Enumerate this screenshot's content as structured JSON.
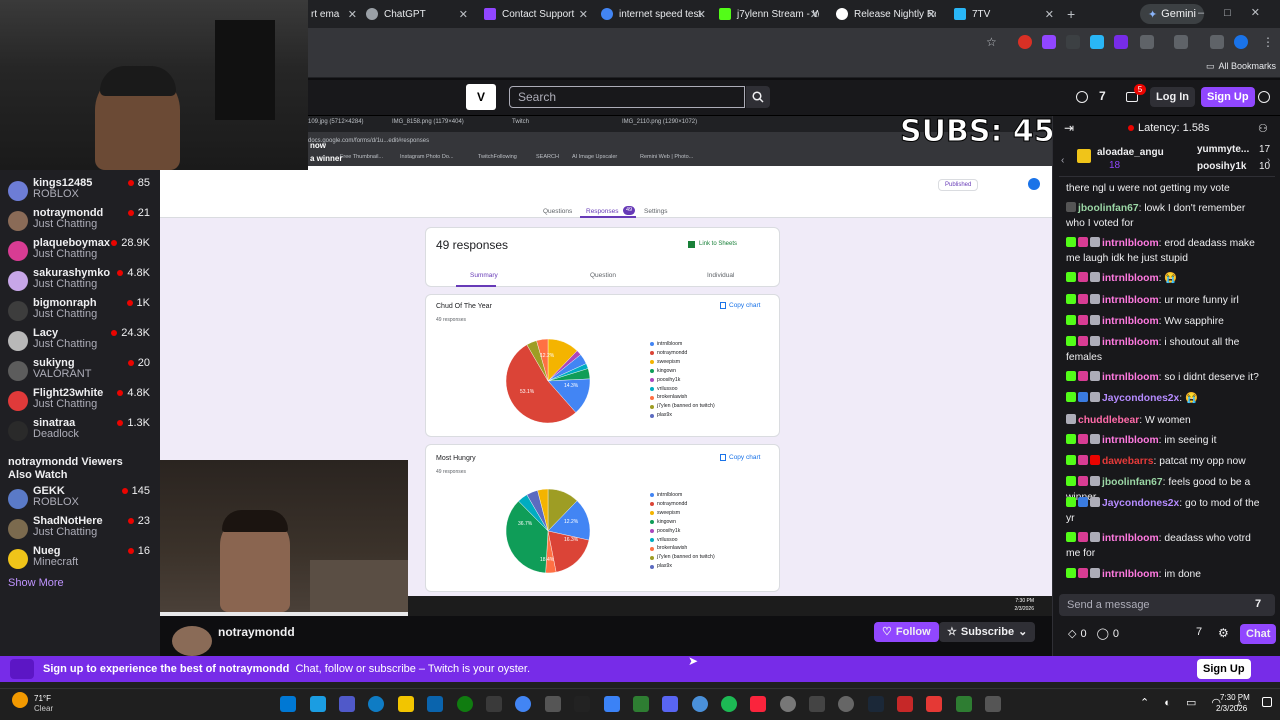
{
  "browser": {
    "tabs": [
      {
        "label": "rt ema",
        "color": "#5f6368"
      },
      {
        "label": "ChatGPT",
        "color": "#9aa0a6"
      },
      {
        "label": "Contact Support",
        "color": "#9146ff"
      },
      {
        "label": "internet speed test",
        "color": "#4285f4"
      },
      {
        "label": "j7ylenn Stream - W",
        "color": "#53fc18"
      },
      {
        "label": "Release Nightly Rel",
        "color": "#ffffff"
      },
      {
        "label": "7TV",
        "color": "#29b6f6"
      }
    ],
    "gemini_label": "Gemini",
    "all_bookmarks": "All Bookmarks"
  },
  "twitch": {
    "search_placeholder": "Search",
    "notif_count": "5",
    "login_label": "Log In",
    "signup_label": "Sign Up"
  },
  "sidebar": {
    "channels": [
      {
        "name": "kings12485",
        "game": "ROBLOX",
        "viewers": "85",
        "color": "#6d7dd6"
      },
      {
        "name": "notraymondd",
        "game": "Just Chatting",
        "viewers": "21",
        "color": "#8a6b57"
      },
      {
        "name": "plaqueboymax",
        "game": "Just Chatting",
        "viewers": "28.9K",
        "color": "#d83c93"
      },
      {
        "name": "sakurashymko",
        "game": "Just Chatting",
        "viewers": "4.8K",
        "color": "#c7a6e8"
      },
      {
        "name": "bigmonraph",
        "game": "Just Chatting",
        "viewers": "1K",
        "color": "#3d3d3d"
      },
      {
        "name": "Lacy",
        "game": "Just Chatting",
        "viewers": "24.3K",
        "color": "#b8b8b8"
      },
      {
        "name": "sukiyng",
        "game": "VALORANT",
        "viewers": "20",
        "color": "#5c5c5c"
      },
      {
        "name": "Flight23white",
        "game": "Just Chatting",
        "viewers": "4.8K",
        "color": "#e03a3a"
      },
      {
        "name": "sinatraa",
        "game": "Deadlock",
        "viewers": "1.3K",
        "color": "#2a2a2a"
      }
    ],
    "also_watch_heading": "notraymondd Viewers Also Watch",
    "also_watch": [
      {
        "name": "GEKK",
        "game": "ROBLOX",
        "viewers": "145",
        "color": "#5a7ac7"
      },
      {
        "name": "ShadNotHere",
        "game": "Just Chatting",
        "viewers": "23",
        "color": "#7b6a4e"
      },
      {
        "name": "Nueg",
        "game": "Minecraft",
        "viewers": "16",
        "color": "#f0c419"
      }
    ],
    "show_more": "Show More"
  },
  "stream": {
    "subs_overlay": "SUBS: 45",
    "inner_tabs": [
      "109.jpg (5712×4284)",
      "IMG_8158.png (1179×404)",
      "Twitch",
      "IMG_2110.png (1290×1072)"
    ],
    "inner_url": "docs.google.com/forms/d/1u...edit#responses",
    "inner_bookmarks": [
      "Free Thumbnail...",
      "Instagram Photo Do...",
      "TwitchFollowing",
      "SEARCH",
      "AI Image Upscaler",
      "Remini Web | Photo..."
    ],
    "now_winner": "now",
    "winner_line": "a winner",
    "forms": {
      "tabs": [
        "Questions",
        "Responses",
        "Settings"
      ],
      "responses_badge": "49",
      "published_label": "Published",
      "responses_title": "49 responses",
      "link_to_sheets": "Link to Sheets",
      "subtabs": [
        "Summary",
        "Question",
        "Individual"
      ],
      "copy_chart": "Copy chart",
      "legend": [
        "intrnlbloom",
        "notraymondd",
        "sweepism",
        "kingown",
        "poosihy1k",
        "vrilussoo",
        "brokenlawish",
        "j7ylen (banned on twitch)",
        "plas9x"
      ],
      "legend_colors": [
        "#4285f4",
        "#db4437",
        "#f4b400",
        "#0f9d58",
        "#ab47bc",
        "#00acc1",
        "#ff7043",
        "#9e9d24",
        "#5c6bc0"
      ],
      "cards": [
        {
          "title": "Chud Of The Year",
          "sub": "49 responses",
          "labels": [
            "53.1%",
            "14.3%",
            "12.2%"
          ]
        },
        {
          "title": "Most Hungry",
          "sub": "49 responses",
          "labels": [
            "36.7%",
            "16.3%",
            "12.2%",
            "18.4%"
          ]
        }
      ]
    },
    "inner_clock": "7:30 PM",
    "inner_date": "2/3/2026"
  },
  "streaminfo": {
    "channel_name": "notraymondd",
    "follow_label": "Follow",
    "subscribe_label": "Subscribe"
  },
  "chat": {
    "latency": "Latency: 1.58s",
    "gift_leader_1": "aloadae_angu",
    "gift_leader_1_count": "18",
    "gift_leader_2": "yummyte...",
    "gift_leader_2_count": "17",
    "gift_leader_3": "poosihy1k",
    "gift_leader_3_count": "10",
    "messages": [
      {
        "user": "",
        "color": "#efeff1",
        "text": "there ngl u were not getting my vote"
      },
      {
        "user": "jboolinfan67",
        "color": "#9bd6a5",
        "text": "lowk I don't remember who I voted for"
      },
      {
        "user": "intrnlbloom",
        "color": "#ff7ae0",
        "text": "erod deadass make me laugh idk he just stupid"
      },
      {
        "user": "intrnlbloom",
        "color": "#ff7ae0",
        "text": "😭"
      },
      {
        "user": "intrnlbloom",
        "color": "#ff7ae0",
        "text": "ur more funny irl"
      },
      {
        "user": "intrnlbloom",
        "color": "#ff7ae0",
        "text": "Ww sapphire"
      },
      {
        "user": "intrnlbloom",
        "color": "#ff7ae0",
        "text": "i shoutout all the females"
      },
      {
        "user": "intrnlbloom",
        "color": "#ff7ae0",
        "text": "so i didnt deserve it?"
      },
      {
        "user": "Jaycondones2x",
        "color": "#b58bff",
        "text": "😭"
      },
      {
        "user": "chuddlebear",
        "color": "#ff6ba9",
        "text": "W women"
      },
      {
        "user": "intrnlbloom",
        "color": "#ff7ae0",
        "text": "im seeing it"
      },
      {
        "user": "dawebarrs",
        "color": "#e63a3a",
        "text": "patcat my opp now"
      },
      {
        "user": "jboolinfan67",
        "color": "#9bd6a5",
        "text": "feels good to be a winner"
      },
      {
        "user": "Jaycondones2x",
        "color": "#b58bff",
        "text": "go to mod of the yr"
      },
      {
        "user": "intrnlbloom",
        "color": "#ff7ae0",
        "text": "deadass who votrd me for"
      },
      {
        "user": "intrnlbloom",
        "color": "#ff7ae0",
        "text": "im done"
      }
    ],
    "input_placeholder": "Send a message",
    "points_1": "0",
    "points_2": "0",
    "chat_button": "Chat"
  },
  "banner": {
    "text_bold": "Sign up to experience the best of notraymondd",
    "text": "Chat, follow or subscribe – Twitch is your oyster.",
    "signup_label": "Sign Up"
  },
  "taskbar": {
    "weather_temp": "71°F",
    "weather_desc": "Clear",
    "time": "7:30 PM",
    "date": "2/3/2026"
  }
}
